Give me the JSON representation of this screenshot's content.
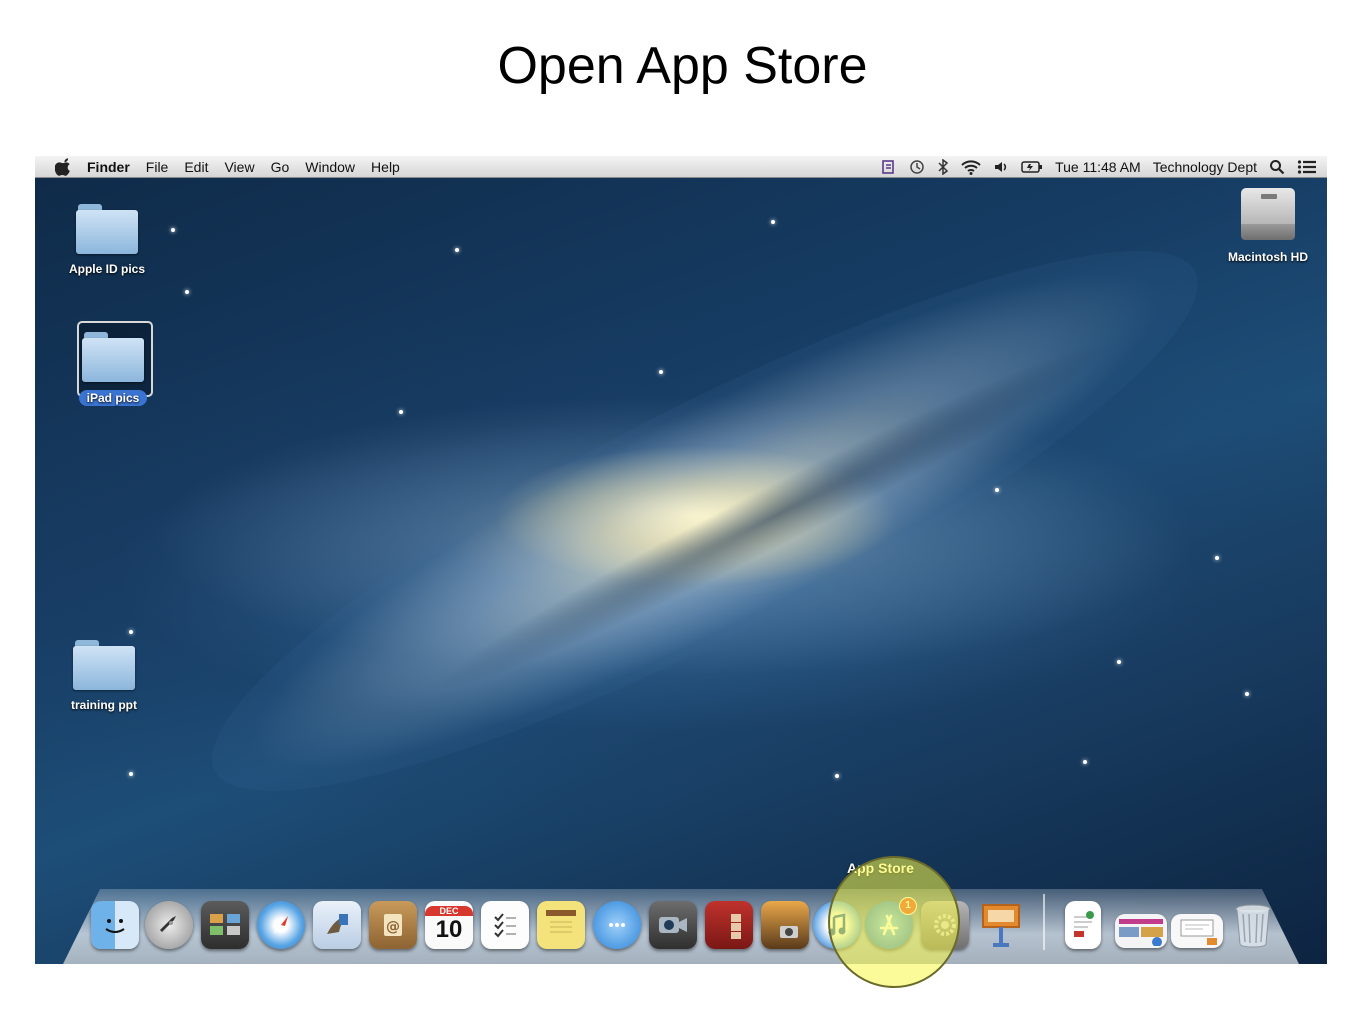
{
  "slide": {
    "title": "Open App Store"
  },
  "menubar": {
    "items": [
      "Finder",
      "File",
      "Edit",
      "View",
      "Go",
      "Window",
      "Help"
    ],
    "clock": "Tue 11:48 AM",
    "user": "Technology Dept"
  },
  "desktop": {
    "icons": [
      {
        "label": "Apple ID pics",
        "type": "folder"
      },
      {
        "label": "iPad pics",
        "type": "folder",
        "selected": true
      },
      {
        "label": "training ppt",
        "type": "folder"
      },
      {
        "label": "Macintosh HD",
        "type": "hard-drive"
      }
    ]
  },
  "dock": {
    "tooltip": "App Store",
    "calendar_month": "DEC",
    "calendar_day": "10",
    "app_store_badge": "1",
    "highlight_color": "#f8f846"
  }
}
